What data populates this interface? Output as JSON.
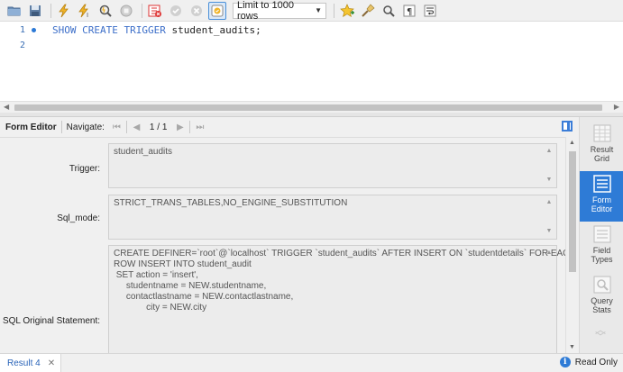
{
  "toolbar": {
    "icons": [
      "open-folder-icon",
      "save-icon",
      "execute-icon",
      "execute-current-icon",
      "explain-icon",
      "stop-icon",
      "toggle-error-icon",
      "commit-icon",
      "rollback-icon",
      "autocommit-icon",
      "favorite-icon",
      "beautify-icon",
      "find-icon",
      "invisible-chars-icon",
      "wrap-icon"
    ],
    "limit_value": "Limit to 1000 rows"
  },
  "editor": {
    "lines": [
      {
        "number": "1",
        "keyword": "SHOW CREATE TRIGGER",
        "ident": " student_audits;"
      },
      {
        "number": "2",
        "keyword": "",
        "ident": ""
      }
    ]
  },
  "result_toolbar": {
    "form_editor_label": "Form Editor",
    "navigate_label": "Navigate:",
    "record_count": "1 / 1"
  },
  "form": {
    "trigger_label": "Trigger:",
    "trigger_value": "student_audits",
    "sql_mode_label": "Sql_mode:",
    "sql_mode_value": "STRICT_TRANS_TABLES,NO_ENGINE_SUBSTITUTION",
    "statement_label": "SQL Original Statement:",
    "statement_lines": [
      "CREATE DEFINER=`root`@`localhost` TRIGGER `student_audits` AFTER INSERT ON `studentdetails` FOR EACH",
      "ROW INSERT INTO student_audit",
      " SET action = 'insert',",
      "     studentname = NEW.studentname,",
      "     contactlastname = NEW.contactlastname,",
      "             city = NEW.city"
    ]
  },
  "side_panel": {
    "items": [
      {
        "label_1": "Result",
        "label_2": "Grid"
      },
      {
        "label_1": "Form",
        "label_2": "Editor"
      },
      {
        "label_1": "Field",
        "label_2": "Types"
      },
      {
        "label_1": "Query",
        "label_2": "Stats"
      }
    ]
  },
  "status": {
    "tab_label": "Result 4",
    "read_only": "Read Only"
  },
  "colors": {
    "accent": "#2e7bd6",
    "keyword": "#3d6fc9"
  }
}
